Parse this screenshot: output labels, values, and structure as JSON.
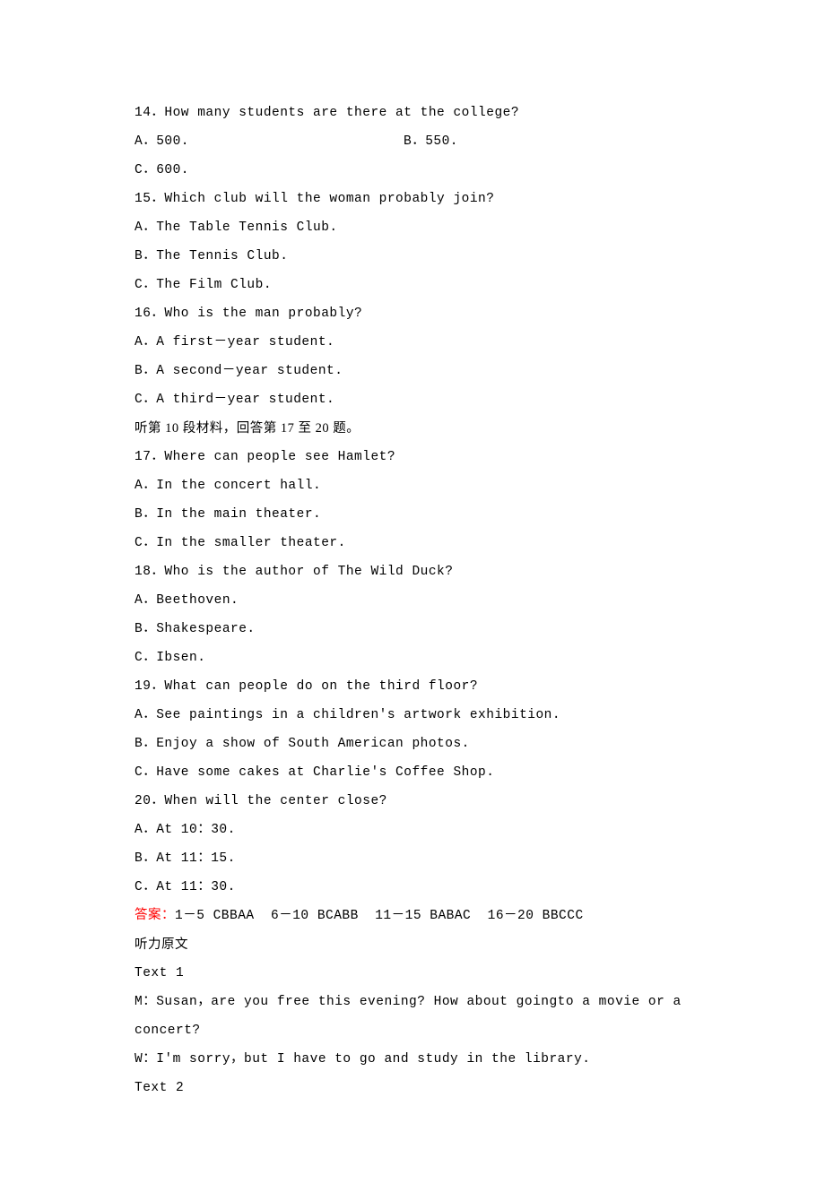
{
  "q14": {
    "text": "14．How many students are there at the college?",
    "a": "A．500.",
    "b": "B．550.",
    "c": "C．600."
  },
  "q15": {
    "text": "15．Which club will the woman probably join?",
    "a": "A．The Table Tennis Club.",
    "b": "B．The Tennis Club.",
    "c": "C．The Film Club."
  },
  "q16": {
    "text": "16．Who is the man probably?",
    "a": "A．A first－year student.",
    "b": "B．A second－year student.",
    "c": "C．A third－year student."
  },
  "instr10": "听第 10 段材料，回答第 17 至 20 题。",
  "q17": {
    "text": "17．Where can people see Hamlet?",
    "a": "A．In the concert hall.",
    "b": "B．In the main theater.",
    "c": "C．In the smaller theater."
  },
  "q18": {
    "text": "18．Who is the author of The Wild Duck?",
    "a": "A．Beethoven.",
    "b": "B．Shakespeare.",
    "c": "C．Ibsen."
  },
  "q19": {
    "text": "19．What can people do on the third floor?",
    "a": "A．See paintings in a children's artwork exhibition.",
    "b": "B．Enjoy a show of South American photos.",
    "c": "C．Have some cakes at Charlie's Coffee Shop."
  },
  "q20": {
    "text": "20．When will the center close?",
    "a": "A．At 10：30.",
    "b": "B．At 11：15.",
    "c": "C．At 11：30."
  },
  "answers": {
    "prefix": "答案：",
    "body": "1－5 CBBAA  6－10 BCABB  11－15 BABAC  16－20 BBCCC"
  },
  "transcript_header": "听力原文",
  "text1": {
    "label": "Text 1",
    "m": "M：Susan，are you free this evening? How about goingto a movie or a concert?",
    "w": "W：I'm sorry，but I have to go and study in the library."
  },
  "text2": {
    "label": "Text 2"
  }
}
